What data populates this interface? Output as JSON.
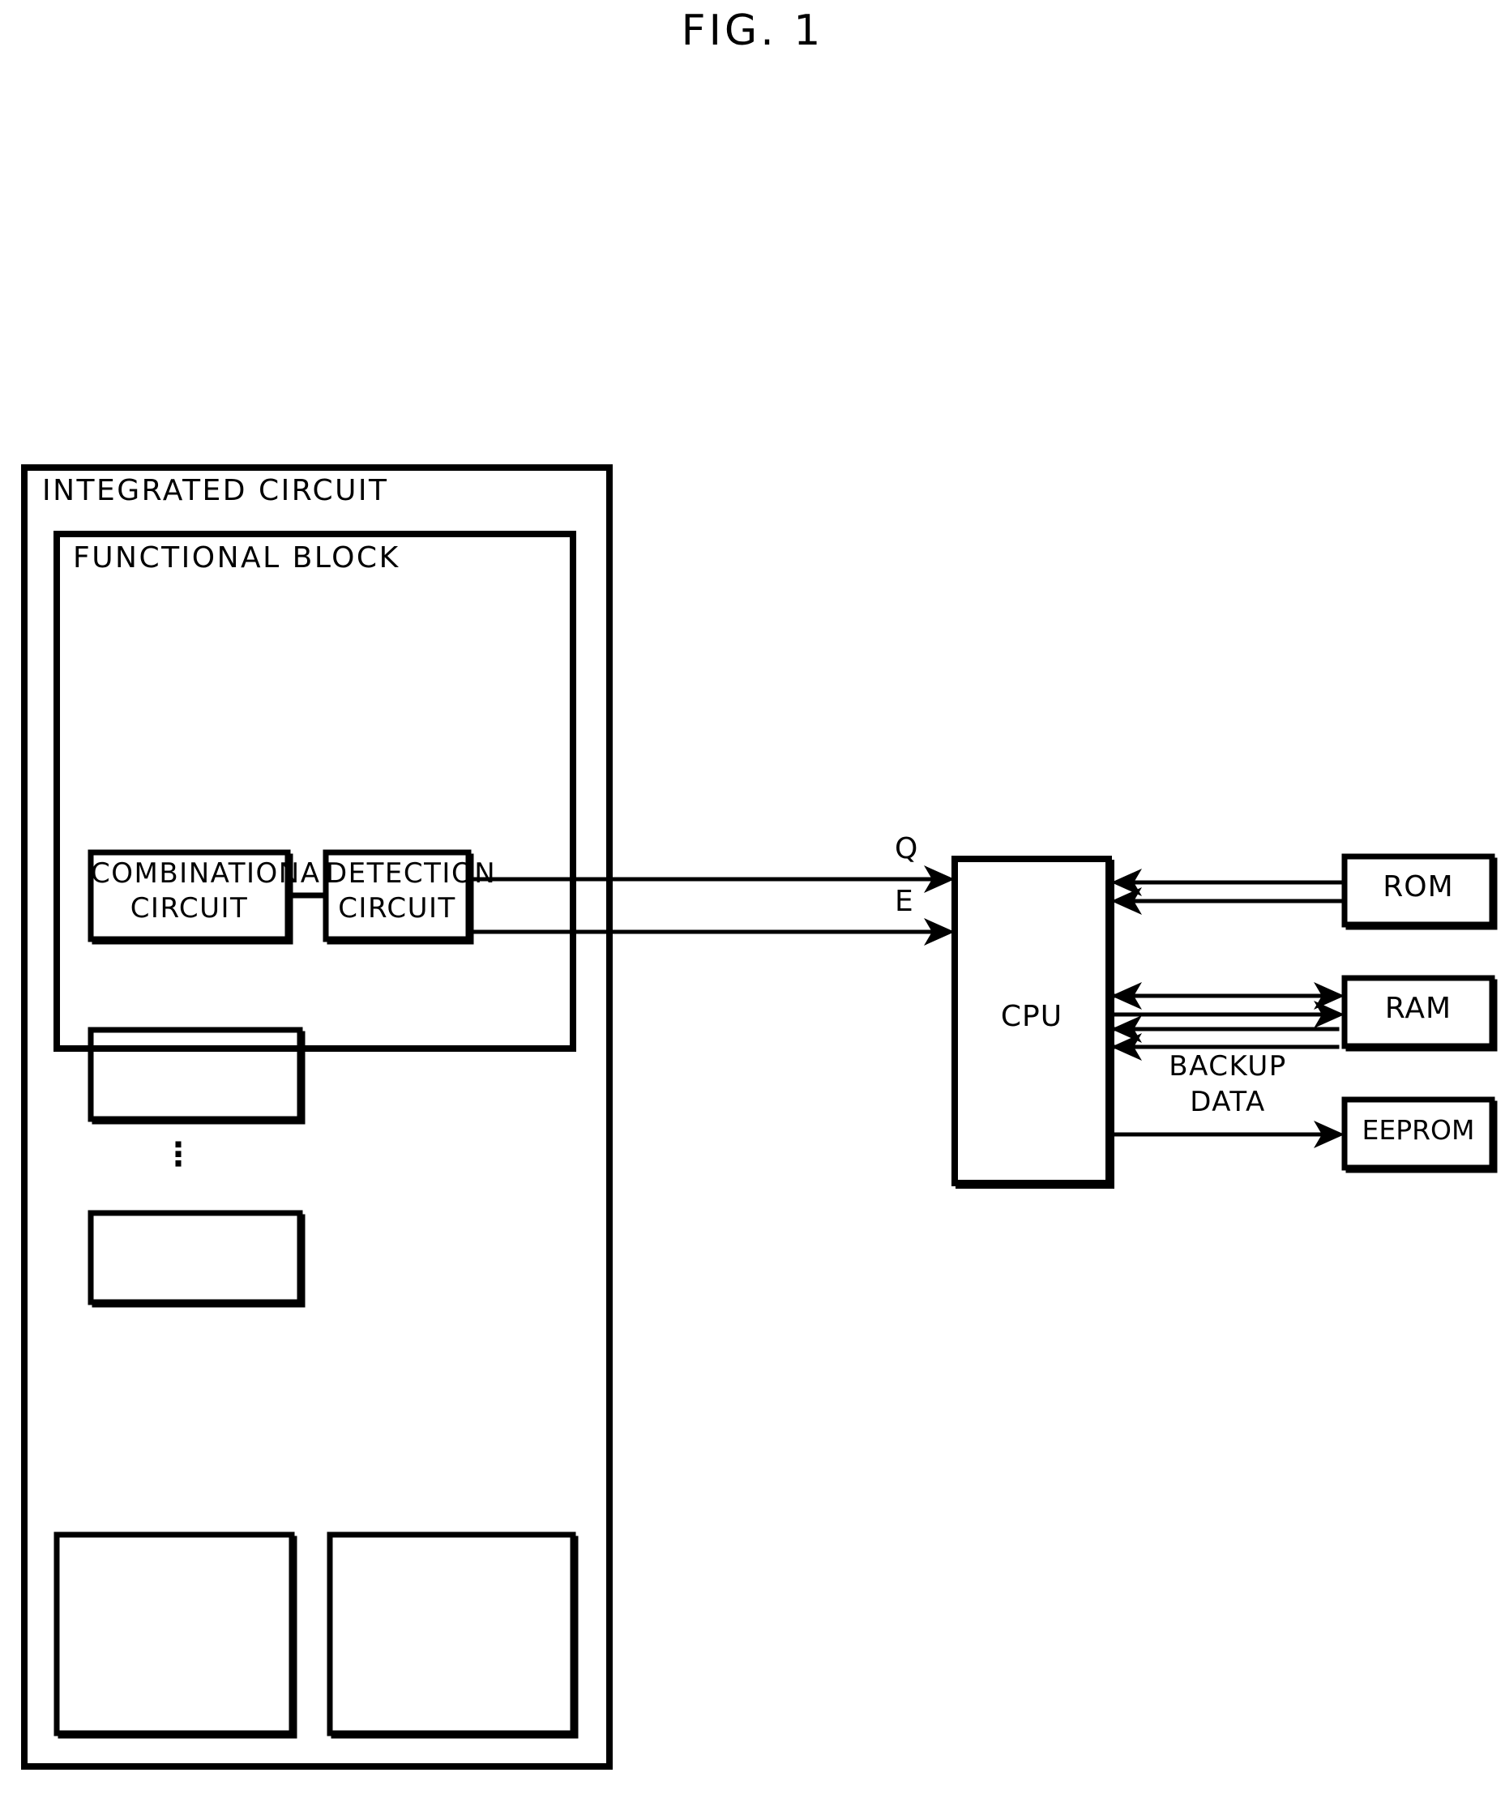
{
  "figure": {
    "title": "FIG. 1",
    "domain": "patent-block-diagram"
  },
  "outer_block": {
    "label": "INTEGRATED CIRCUIT"
  },
  "functional_block": {
    "label": "FUNCTIONAL BLOCK",
    "boxes": [
      {
        "id": "combinational-circuit",
        "line1": "COMBINATIONAL",
        "line2": "CIRCUIT"
      },
      {
        "id": "detection-circuit",
        "line1": "DETECTION",
        "line2": "CIRCUIT"
      },
      {
        "id": "unlabeled-block-1",
        "line1": "",
        "line2": ""
      },
      {
        "id": "unlabeled-block-2",
        "line1": "",
        "line2": ""
      }
    ],
    "ellipsis": "⋮"
  },
  "signals": {
    "q_label": "Q",
    "e_label": "E",
    "backup_data_line1": "BACKUP",
    "backup_data_line2": "DATA"
  },
  "processor": {
    "label": "CPU"
  },
  "memories": [
    {
      "id": "rom",
      "label": "ROM"
    },
    {
      "id": "ram",
      "label": "RAM"
    },
    {
      "id": "eeprom",
      "label": "EEPROM"
    }
  ],
  "bottom_blocks": [
    {
      "id": "bottom-block-left",
      "label": ""
    },
    {
      "id": "bottom-block-right",
      "label": ""
    }
  ],
  "colors": {
    "line": "#000000",
    "background": "#ffffff",
    "text": "#000000"
  }
}
